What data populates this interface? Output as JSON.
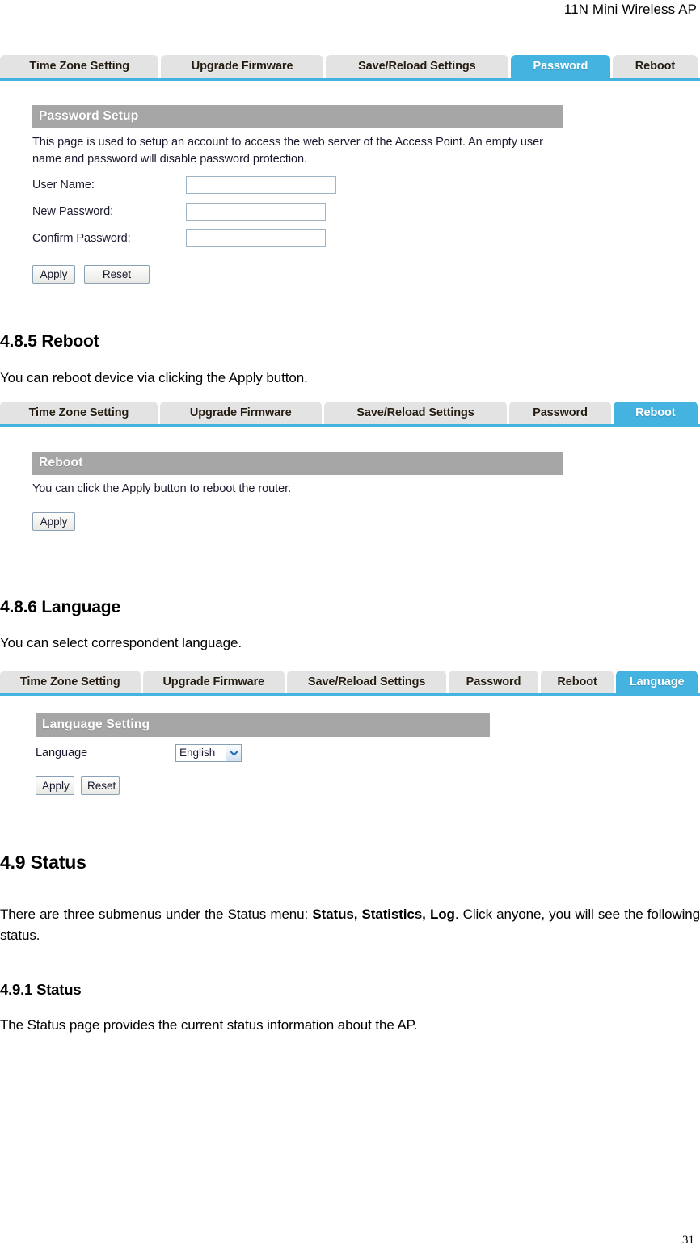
{
  "document": {
    "running_head": "11N Mini Wireless AP",
    "page_number": "31"
  },
  "tabbars": {
    "password_bar": {
      "tabs": [
        {
          "label": "Time Zone Setting",
          "active": false
        },
        {
          "label": "Upgrade Firmware",
          "active": false
        },
        {
          "label": "Save/Reload Settings",
          "active": false
        },
        {
          "label": "Password",
          "active": true
        },
        {
          "label": "Reboot",
          "active": false
        }
      ]
    },
    "reboot_bar": {
      "tabs": [
        {
          "label": "Time Zone Setting",
          "active": false
        },
        {
          "label": "Upgrade Firmware",
          "active": false
        },
        {
          "label": "Save/Reload Settings",
          "active": false
        },
        {
          "label": "Password",
          "active": false
        },
        {
          "label": "Reboot",
          "active": true
        }
      ]
    },
    "language_bar": {
      "tabs": [
        {
          "label": "Time Zone Setting",
          "active": false
        },
        {
          "label": "Upgrade Firmware",
          "active": false
        },
        {
          "label": "Save/Reload Settings",
          "active": false
        },
        {
          "label": "Password",
          "active": false
        },
        {
          "label": "Reboot",
          "active": false
        },
        {
          "label": "Language",
          "active": true
        }
      ]
    }
  },
  "password_panel": {
    "title": "Password Setup",
    "description": "This page is used to setup an account to access the web server of the Access Point. An empty user name and password will disable password protection.",
    "fields": [
      {
        "label": "User Name:",
        "value": "",
        "placeholder": ""
      },
      {
        "label": "New Password:",
        "value": "",
        "placeholder": ""
      },
      {
        "label": "Confirm Password:",
        "value": "",
        "placeholder": ""
      }
    ],
    "apply_label": "Apply",
    "reset_label": "Reset"
  },
  "reboot_section": {
    "heading": "4.8.5 Reboot",
    "intro": "You can reboot device via clicking the Apply button.",
    "panel": {
      "title": "Reboot",
      "description": "You can click the Apply button to reboot the router.",
      "apply_label": "Apply"
    }
  },
  "language_section": {
    "heading": "4.8.6 Language",
    "intro": "You can select correspondent  language.",
    "panel": {
      "title": "Language Setting",
      "field_label": "Language",
      "selected_value": "English",
      "options": [
        "English"
      ],
      "apply_label": "Apply",
      "reset_label": "Reset"
    }
  },
  "status_section": {
    "heading": "4.9 Status",
    "paragraph_prefix": "There are three submenus under the Status menu: ",
    "paragraph_bold": "Status, Statistics, Log",
    "paragraph_suffix": ". Click anyone, you will see the following status.",
    "subheading": "4.9.1 Status",
    "sub_paragraph": "The Status page provides the current status information about the AP."
  },
  "colors": {
    "tab_active": "#45b3e0",
    "tab_inactive": "#e3e3e3",
    "panel_header": "#a6a6a6",
    "input_border": "#9db3c6"
  }
}
